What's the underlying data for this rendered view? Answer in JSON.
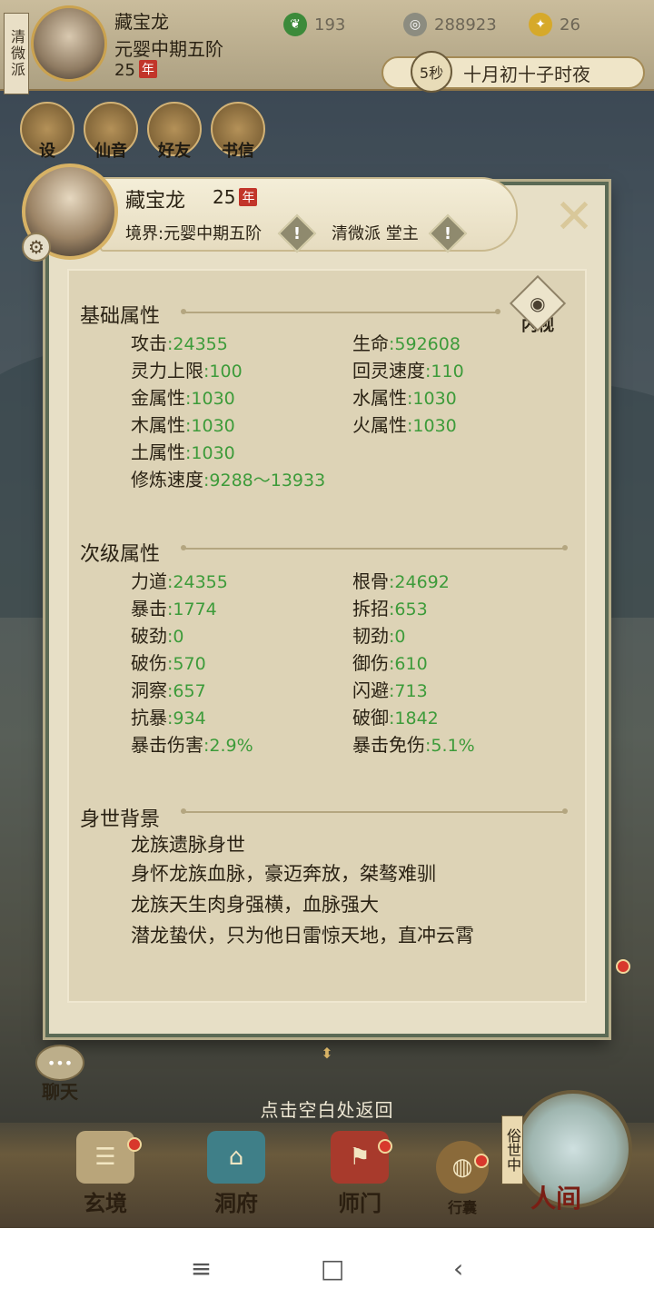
{
  "topbar": {
    "sect_tag": "清微派",
    "name": "藏宝龙",
    "realm": "元婴中期五阶",
    "age": "25",
    "nian": "年",
    "resources": [
      {
        "icon": "jade-icon",
        "value": "193",
        "color": "#3c8a3a"
      },
      {
        "icon": "coin-icon",
        "value": "288923",
        "color": "#8c8c80"
      },
      {
        "icon": "strength-icon",
        "value": "26",
        "color": "#d6a92a"
      }
    ],
    "timer": "5秒",
    "time_text": "十月初十子时夜",
    "quick_icons": [
      {
        "label": "设",
        "icon": "settings-icon"
      },
      {
        "label": "仙音",
        "icon": "music-icon"
      },
      {
        "label": "好友",
        "icon": "friends-icon"
      },
      {
        "label": "书信",
        "icon": "letter-icon"
      }
    ]
  },
  "panel": {
    "name": "藏宝龙",
    "age": "25",
    "nian": "年",
    "realm": "境界:元婴中期五阶",
    "sect": "清微派 堂主",
    "eye_label": "内视",
    "close_symbol": "✕",
    "basic": {
      "title": "基础属性",
      "left": [
        {
          "label": "攻击",
          "value": ":24355"
        },
        {
          "label": "灵力上限",
          "value": ":100"
        },
        {
          "label": "金属性",
          "value": ":1030"
        },
        {
          "label": "木属性",
          "value": ":1030"
        },
        {
          "label": "土属性",
          "value": ":1030"
        },
        {
          "label": "修炼速度",
          "value": ":9288～13933"
        }
      ],
      "right": [
        {
          "label": "生命",
          "value": ":592608"
        },
        {
          "label": "回灵速度",
          "value": ":110"
        },
        {
          "label": "水属性",
          "value": ":1030"
        },
        {
          "label": "火属性",
          "value": ":1030"
        }
      ]
    },
    "secondary": {
      "title": "次级属性",
      "left": [
        {
          "label": "力道",
          "value": ":24355"
        },
        {
          "label": "暴击",
          "value": ":1774"
        },
        {
          "label": "破劲",
          "value": ":0"
        },
        {
          "label": "破伤",
          "value": ":570"
        },
        {
          "label": "洞察",
          "value": ":657"
        },
        {
          "label": "抗暴",
          "value": ":934"
        },
        {
          "label": "暴击伤害",
          "value": ":2.9%"
        }
      ],
      "right": [
        {
          "label": "根骨",
          "value": ":24692"
        },
        {
          "label": "拆招",
          "value": ":653"
        },
        {
          "label": "韧劲",
          "value": ":0"
        },
        {
          "label": "御伤",
          "value": ":610"
        },
        {
          "label": "闪避",
          "value": ":713"
        },
        {
          "label": "破御",
          "value": ":1842"
        },
        {
          "label": "暴击免伤",
          "value": ":5.1%"
        }
      ]
    },
    "background": {
      "title": "身世背景",
      "lines": [
        "龙族遗脉身世",
        "身怀龙族血脉，豪迈奔放，桀骜难驯",
        "龙族天生肉身强横，血脉强大",
        "潜龙蛰伏，只为他日雷惊天地，直冲云霄"
      ]
    }
  },
  "chat_label": "聊天",
  "return_hint": "点击空白处返回",
  "bottom_nav": [
    {
      "label": "玄境",
      "icon": "scroll-icon"
    },
    {
      "label": "洞府",
      "icon": "pavilion-icon"
    },
    {
      "label": "师门",
      "icon": "banner-icon"
    },
    {
      "label": "行囊",
      "icon": "bag-icon"
    }
  ],
  "world": {
    "label": "人间",
    "side": "俗世中"
  },
  "system_nav": {
    "menu": "≡",
    "home": "□",
    "back": "‹"
  }
}
